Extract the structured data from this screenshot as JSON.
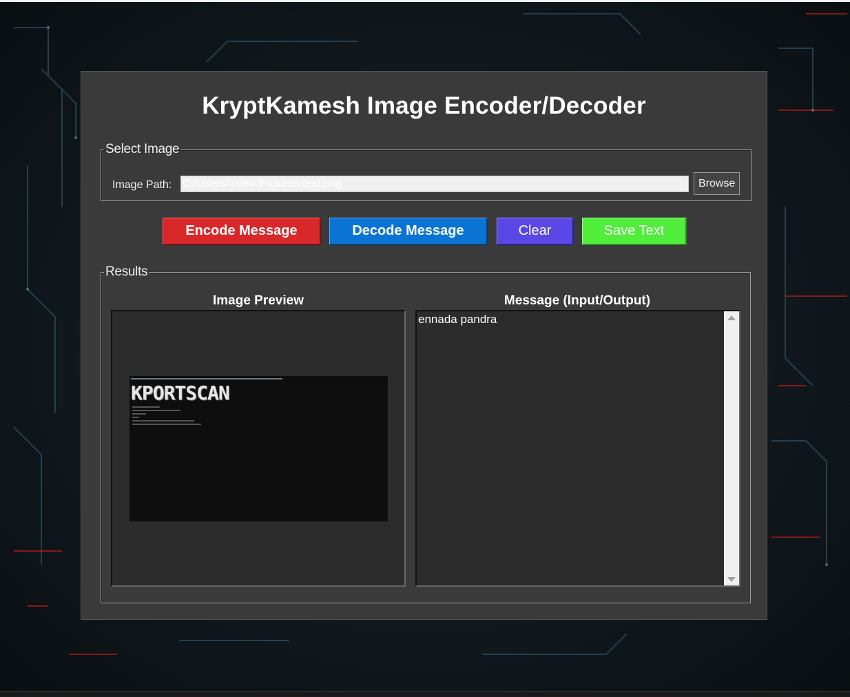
{
  "app": {
    "title": "KryptKamesh Image Encoder/Decoder"
  },
  "select_image": {
    "legend": "Select Image",
    "path_label": "Image Path:",
    "path_value": "C:/Users/lovew/Pictures/test.png",
    "browse_label": "Browse"
  },
  "actions": {
    "encode_label": "Encode Message",
    "decode_label": "Decode Message",
    "clear_label": "Clear",
    "save_label": "Save Text"
  },
  "results": {
    "legend": "Results",
    "preview_heading": "Image Preview",
    "message_heading": "Message (Input/Output)",
    "message_text": "ennada pandra",
    "preview_logo_text": "KPORTSCAN"
  },
  "colors": {
    "window_bg": "#3a3a3a",
    "encode": "#d9282a",
    "decode": "#0a74d4",
    "clear": "#5b46e6",
    "save": "#50ee3a"
  },
  "icons": {
    "scroll_up": "triangle-up-icon",
    "scroll_down": "triangle-down-icon"
  }
}
